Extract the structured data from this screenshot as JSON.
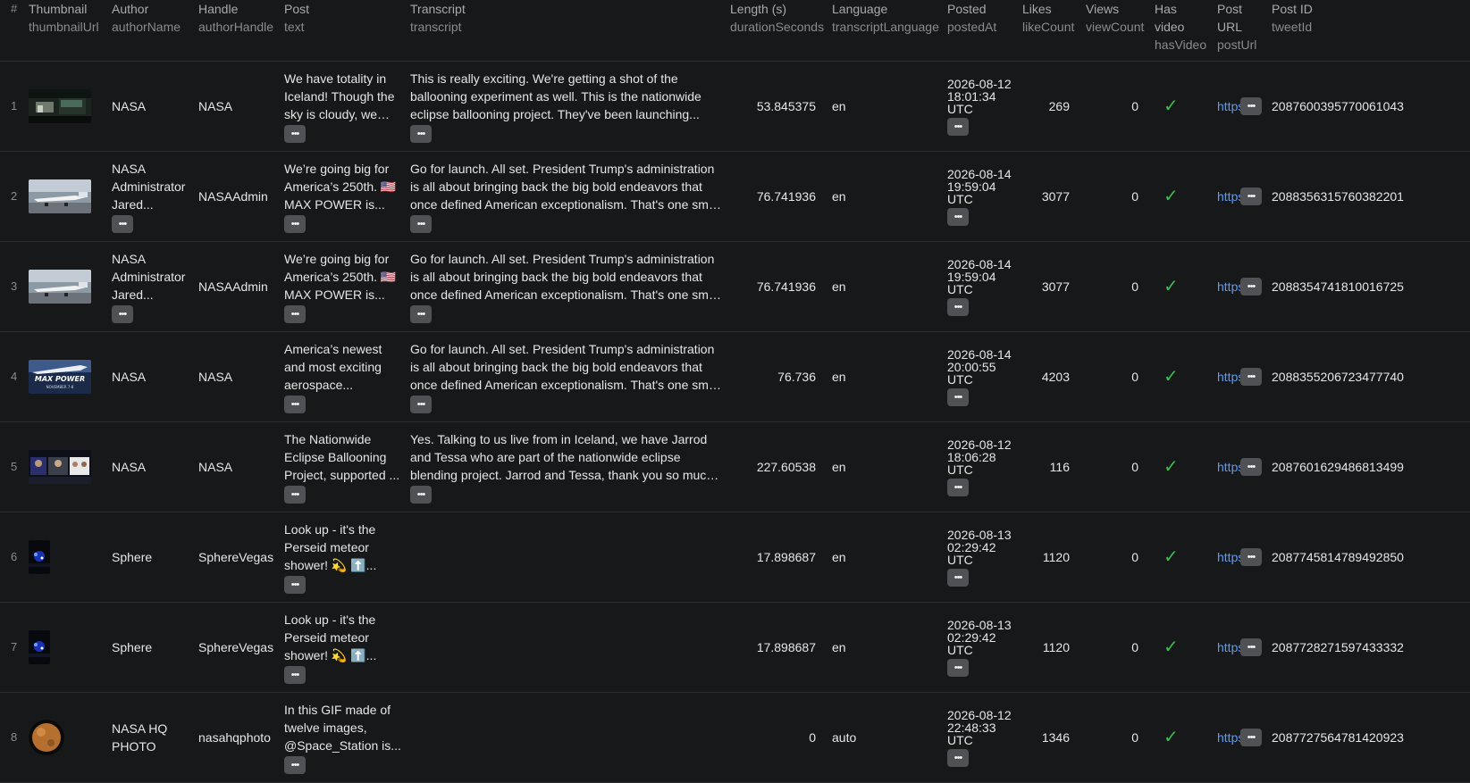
{
  "columns": [
    {
      "label": "#",
      "key": ""
    },
    {
      "label": "Thumbnail",
      "key": "thumbnailUrl"
    },
    {
      "label": "Author",
      "key": "authorName"
    },
    {
      "label": "Handle",
      "key": "authorHandle"
    },
    {
      "label": "Post",
      "key": "text"
    },
    {
      "label": "Transcript",
      "key": "transcript"
    },
    {
      "label": "Length (s)",
      "key": "durationSeconds"
    },
    {
      "label": "Language",
      "key": "transcriptLanguage"
    },
    {
      "label": "Posted",
      "key": "postedAt"
    },
    {
      "label": "Likes",
      "key": "likeCount"
    },
    {
      "label": "Views",
      "key": "viewCount"
    },
    {
      "label": "Has video",
      "key": "hasVideo"
    },
    {
      "label": "Post URL",
      "key": "postUrl"
    },
    {
      "label": "Post ID",
      "key": "tweetId"
    }
  ],
  "more_glyph": "•••",
  "check_glyph": "✓",
  "rows": [
    {
      "idx": "1",
      "thumb": "dark-wide",
      "author": "NASA",
      "handle": "NASA",
      "post": "We have totality in Iceland! Though the sky is cloudy, we ca...",
      "transcript": "This is really exciting. We're getting a shot of the ballooning experiment as well. This is the nationwide eclipse ballooning project. They've been launching...",
      "length": "53.845375",
      "language": "en",
      "posted": "2026-08-12 18:01:34 UTC",
      "likes": "269",
      "views": "0",
      "url": "https:/...",
      "id": "2087600395770061043",
      "author_more": false
    },
    {
      "idx": "2",
      "thumb": "jet",
      "author": "NASA Administrator Jared...",
      "handle": "NASAAdmin",
      "post": "We’re going big for America’s 250th. 🇺🇸 MAX POWER is...",
      "transcript": "Go for launch. All set. President Trump's administration is all about bringing back the big bold endeavors that once defined American exceptionalism. That's one small step...",
      "length": "76.741936",
      "language": "en",
      "posted": "2026-08-14 19:59:04 UTC",
      "likes": "3077",
      "views": "0",
      "url": "https:/...",
      "id": "2088356315760382201",
      "author_more": true
    },
    {
      "idx": "3",
      "thumb": "jet",
      "author": "NASA Administrator Jared...",
      "handle": "NASAAdmin",
      "post": "We’re going big for America’s 250th. 🇺🇸 MAX POWER is...",
      "transcript": "Go for launch. All set. President Trump's administration is all about bringing back the big bold endeavors that once defined American exceptionalism. That's one small step...",
      "length": "76.741936",
      "language": "en",
      "posted": "2026-08-14 19:59:04 UTC",
      "likes": "3077",
      "views": "0",
      "url": "https:/...",
      "id": "2088354741810016725",
      "author_more": true
    },
    {
      "idx": "4",
      "thumb": "maxpower",
      "author": "NASA",
      "handle": "NASA",
      "post": "America’s newest and most exciting aerospace...",
      "transcript": "Go for launch. All set. President Trump's administration is all about bringing back the big bold endeavors that once defined American exceptionalism. That's one small step...",
      "length": "76.736",
      "language": "en",
      "posted": "2026-08-14 20:00:55 UTC",
      "likes": "4203",
      "views": "0",
      "url": "https:/...",
      "id": "2088355206723477740",
      "author_more": false
    },
    {
      "idx": "5",
      "thumb": "news",
      "author": "NASA",
      "handle": "NASA",
      "post": "The Nationwide Eclipse Ballooning Project, supported ...",
      "transcript": "Yes. Talking to us live from in Iceland, we have Jarrod and Tessa who are part of the nationwide eclipse blending project. Jarrod and Tessa, thank you so much for joining...",
      "length": "227.60538",
      "language": "en",
      "posted": "2026-08-12 18:06:28 UTC",
      "likes": "116",
      "views": "0",
      "url": "https:/...",
      "id": "2087601629486813499",
      "author_more": false
    },
    {
      "idx": "6",
      "thumb": "sphere",
      "author": "Sphere",
      "handle": "SphereVegas",
      "post": "Look up - it's the Perseid meteor shower! 💫 ⬆️...",
      "transcript": "",
      "length": "17.898687",
      "language": "en",
      "posted": "2026-08-13 02:29:42 UTC",
      "likes": "1120",
      "views": "0",
      "url": "https:/...",
      "id": "2087745814789492850",
      "author_more": false
    },
    {
      "idx": "7",
      "thumb": "sphere",
      "author": "Sphere",
      "handle": "SphereVegas",
      "post": "Look up - it's the Perseid meteor shower! 💫 ⬆️...",
      "transcript": "",
      "length": "17.898687",
      "language": "en",
      "posted": "2026-08-13 02:29:42 UTC",
      "likes": "1120",
      "views": "0",
      "url": "https:/...",
      "id": "2087728271597433332",
      "author_more": false
    },
    {
      "idx": "8",
      "thumb": "moon",
      "author": "NASA HQ PHOTO",
      "handle": "nasahqphoto",
      "post": "In this GIF made of twelve images, @Space_Station is...",
      "transcript": "",
      "length": "0",
      "language": "auto",
      "posted": "2026-08-12 22:48:33 UTC",
      "likes": "1346",
      "views": "0",
      "url": "https:/...",
      "id": "2087727564781420923",
      "author_more": false
    }
  ]
}
